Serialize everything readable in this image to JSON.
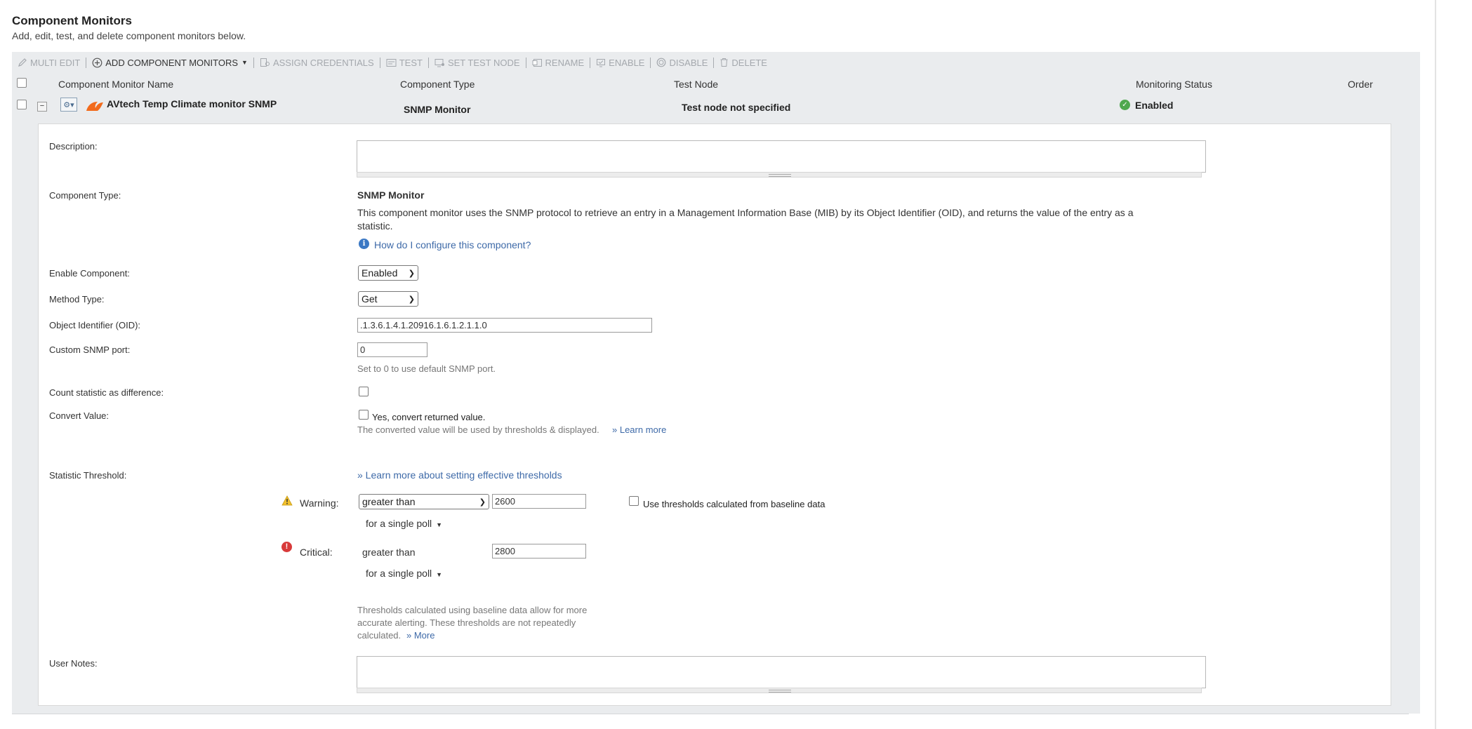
{
  "header": {
    "title": "Component Monitors",
    "subtitle": "Add, edit, test, and delete component monitors below."
  },
  "toolbar": {
    "multi_edit": "MULTI EDIT",
    "add_component_monitors": "ADD COMPONENT MONITORS",
    "assign_credentials": "ASSIGN CREDENTIALS",
    "test": "TEST",
    "set_test_node": "SET TEST NODE",
    "rename": "RENAME",
    "enable": "ENABLE",
    "disable": "DISABLE",
    "delete": "DELETE"
  },
  "grid": {
    "columns": {
      "name": "Component Monitor Name",
      "type": "Component Type",
      "test_node": "Test Node",
      "status": "Monitoring Status",
      "order": "Order"
    },
    "row": {
      "name": "AVtech Temp Climate monitor SNMP",
      "type": "SNMP Monitor",
      "test_node": "Test node not specified",
      "status": "Enabled"
    }
  },
  "detail": {
    "description_label": "Description:",
    "component_type_label": "Component Type:",
    "component_type_value": "SNMP Monitor",
    "component_type_desc_line1": "This component monitor uses the SNMP protocol to retrieve an entry in a Management Information Base (MIB) by its Object Identifier (OID), and returns the value of the entry as a",
    "component_type_desc_line2": "statistic.",
    "how_configure_link": "How do I configure this component?",
    "enable_component_label": "Enable Component:",
    "enable_component_value": "Enabled",
    "method_type_label": "Method Type:",
    "method_type_value": "Get",
    "oid_label": "Object Identifier (OID):",
    "oid_value": ".1.3.6.1.4.1.20916.1.6.1.2.1.1.0",
    "snmp_port_label": "Custom SNMP port:",
    "snmp_port_value": "0",
    "snmp_port_hint": "Set to 0 to use default SNMP port.",
    "count_diff_label": "Count statistic as difference:",
    "convert_value_label": "Convert Value:",
    "convert_value_checkbox": "Yes, convert returned value.",
    "convert_value_hint": "The converted value will be used by thresholds & displayed.",
    "convert_learn_more": "» Learn more",
    "statistic_threshold_label": "Statistic Threshold:",
    "threshold_learn_more": "» Learn more about setting effective thresholds",
    "warning_label": "Warning:",
    "warning_operator": "greater than",
    "warning_value": "2600",
    "warning_poll": "for  a single poll",
    "baseline_checkbox": "Use thresholds calculated from baseline data",
    "critical_label": "Critical:",
    "critical_operator": "greater than",
    "critical_value": "2800",
    "critical_poll": "for  a single poll",
    "baseline_note_line1": "Thresholds calculated using baseline data allow for more",
    "baseline_note_line2": "accurate alerting. These thresholds are not repeatedly",
    "baseline_note_line3": "calculated.",
    "baseline_more": "» More",
    "user_notes_label": "User Notes:"
  },
  "colors": {
    "toolbar_bg": "#eaecee",
    "link": "#3e6aa8",
    "enabled_green": "#4fa84f",
    "critical_red": "#d83a3a",
    "warning_yellow": "#f2c12e",
    "info_blue": "#3b78c4"
  },
  "icons": {
    "multi_edit": "pencil-icon",
    "add": "plus-circle-icon",
    "assign_credentials": "credentials-icon",
    "test": "test-icon",
    "set_test_node": "node-icon",
    "rename": "rename-icon",
    "enable": "enable-icon",
    "disable": "disable-icon",
    "delete": "trash-icon",
    "status": "check-circle-icon",
    "warning": "warning-triangle-icon",
    "critical": "critical-circle-icon",
    "info": "info-circle-icon"
  }
}
